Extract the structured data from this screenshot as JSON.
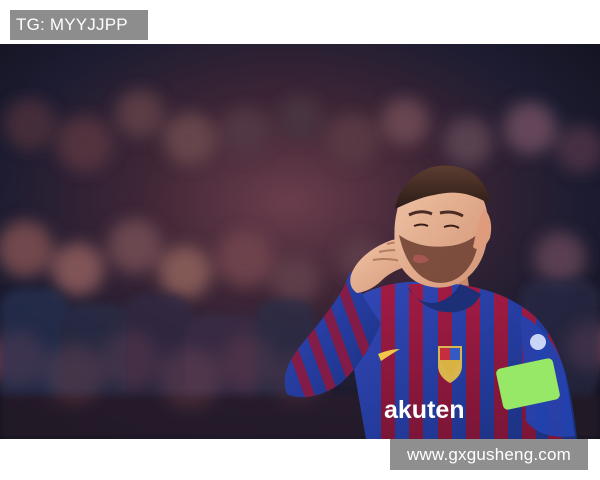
{
  "top_label": "TG: MYYJJPP",
  "bottom_label": "www.gxgusheng.com",
  "photo": {
    "jersey_sponsor": "akuten"
  },
  "colors": {
    "label_bg": "#8d8d8d",
    "label_text": "#ffffff",
    "page_bg": "#ffffff",
    "shirt_blue": "#243b9c",
    "shirt_red": "#8d183e",
    "armband": "#98e868"
  }
}
